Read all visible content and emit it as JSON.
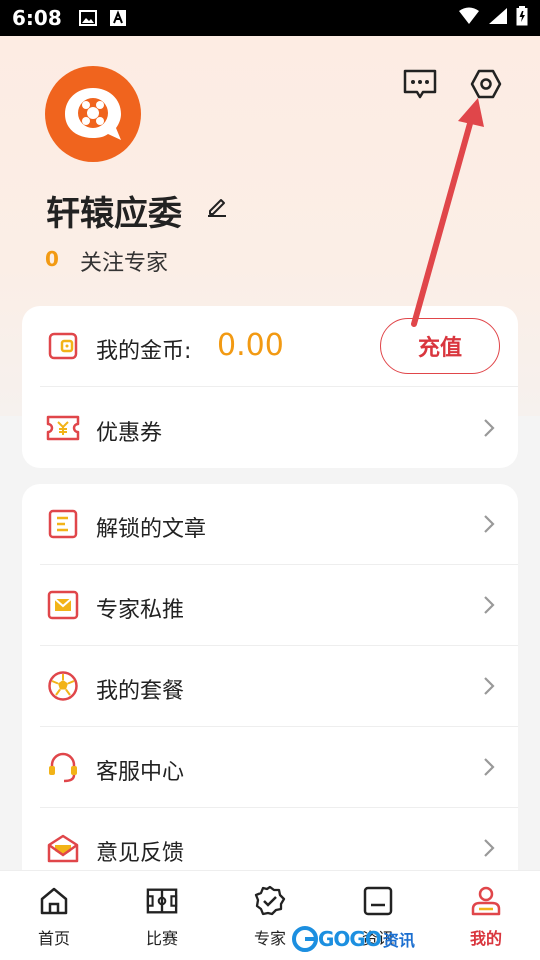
{
  "status_bar": {
    "time": "6:08"
  },
  "profile": {
    "username": "轩辕应委",
    "follow_count": "0",
    "follow_label": "关注专家"
  },
  "wallet": {
    "coin_label": "我的金币:",
    "coin_value": "0.00",
    "recharge_label": "充值",
    "coupon_label": "优惠券"
  },
  "menu": {
    "items": [
      {
        "label": "解锁的文章"
      },
      {
        "label": "专家私推"
      },
      {
        "label": "我的套餐"
      },
      {
        "label": "客服中心"
      },
      {
        "label": "意见反馈"
      }
    ]
  },
  "tabbar": {
    "tabs": [
      {
        "label": "首页"
      },
      {
        "label": "比赛"
      },
      {
        "label": "专家"
      },
      {
        "label": "资讯"
      },
      {
        "label": "我的"
      }
    ],
    "active": "我的"
  },
  "watermark": {
    "text": "GOGO",
    "cn": "资讯"
  },
  "colors": {
    "accent": "#d9363e",
    "coin": "#f29a13",
    "avatar": "#f0641e",
    "arrow": "#e0464a"
  }
}
